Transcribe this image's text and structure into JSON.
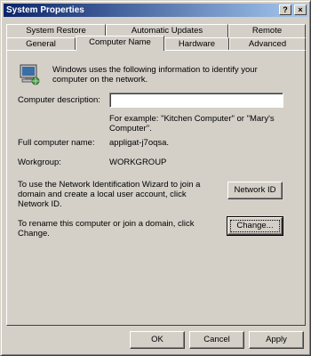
{
  "window": {
    "title": "System Properties",
    "help_label": "?",
    "close_label": "×"
  },
  "tabs_back": [
    "System Restore",
    "Automatic Updates",
    "Remote"
  ],
  "tabs_front": [
    "General",
    "Computer Name",
    "Hardware",
    "Advanced"
  ],
  "active_tab": "Computer Name",
  "content": {
    "intro": "Windows uses the following information to identify your computer on the network.",
    "description_label": "Computer description:",
    "description_value": "",
    "example": "For example: \"Kitchen Computer\" or \"Mary's Computer\".",
    "full_name_label": "Full computer name:",
    "full_name_value": "appligat-j7oqsa.",
    "workgroup_label": "Workgroup:",
    "workgroup_value": "WORKGROUP",
    "network_id_text": "To use the Network Identification Wizard to join a domain and create a local user account, click Network ID.",
    "network_id_button": "Network ID",
    "change_text": "To rename this computer or join a domain, click Change.",
    "change_button": "Change..."
  },
  "footer": {
    "ok": "OK",
    "cancel": "Cancel",
    "apply": "Apply"
  },
  "colors": {
    "face": "#d4d0c8",
    "title_start": "#0a246a",
    "title_end": "#a6caf0"
  }
}
